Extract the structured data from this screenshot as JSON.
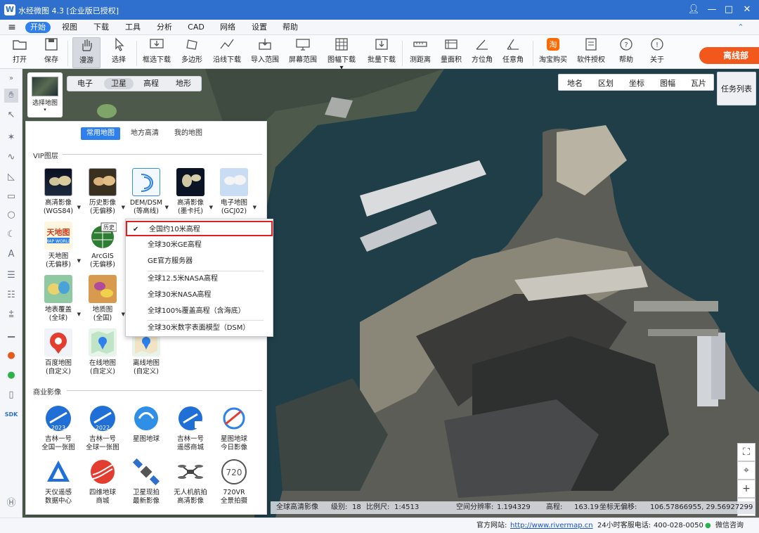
{
  "window": {
    "title": "水经微图 4.3 [企业版已授权]",
    "logo": "W"
  },
  "menu": {
    "items": [
      "开始",
      "视图",
      "下载",
      "工具",
      "分析",
      "CAD",
      "网络",
      "设置",
      "帮助"
    ]
  },
  "ribbon": {
    "open": "打开",
    "save": "保存",
    "roam": "漫游",
    "select": "选择",
    "frame_dl": "框选下载",
    "polygon": "多边形",
    "line_dl": "沿线下载",
    "import_range": "导入范围",
    "screen_range": "屏幕范围",
    "sheet_dl": "图幅下载",
    "batch_dl": "批量下载",
    "measure_dist": "测距离",
    "measure_area": "量面积",
    "azimuth": "方位角",
    "any_angle": "任意角",
    "taobao": "淘宝购买",
    "license": "软件授权",
    "help": "帮助",
    "about": "关于",
    "offline": "离线部"
  },
  "map": {
    "layer_types": [
      "电子",
      "卫星",
      "高程",
      "地形"
    ],
    "active_layer_type": "卫星",
    "thumb_label": "选择地图",
    "top_tabs": [
      "地名",
      "区划",
      "坐标",
      "图幅",
      "瓦片"
    ],
    "tasks": "任务列表",
    "zoom": {
      "in": "+",
      "out": "−"
    }
  },
  "status": {
    "layer": "全球高清影像",
    "level_label": "级别:",
    "level": "18",
    "scale_label": "比例尺:",
    "scale": "1:4513",
    "res_label": "空间分辨率:",
    "res": "1.194329",
    "elev_label": "高程:",
    "elev": "163.19",
    "coord_label": "坐标无偏移:",
    "coord": "106.57866955, 29.56927299"
  },
  "panel": {
    "tabs": [
      "常用地图",
      "地方高清",
      "我的地图"
    ],
    "active_tab": "常用地图",
    "vip_title": "VIP图层",
    "vip_items": [
      {
        "l1": "高清影像",
        "l2": "(WGS84)"
      },
      {
        "l1": "历史影像",
        "l2": "(无偏移)"
      },
      {
        "l1": "DEM/DSM",
        "l2": "(等高线)"
      },
      {
        "l1": "高清影像",
        "l2": "(墨卡托)"
      },
      {
        "l1": "电子地图",
        "l2": "(GCJ02)"
      },
      {
        "l1": "天地图",
        "l2": "(无偏移)"
      },
      {
        "l1": "ArcGIS",
        "l2": "(无偏移)"
      },
      {
        "l1": "地表覆盖",
        "l2": "(全球)"
      },
      {
        "l1": "地质图",
        "l2": "(全国)"
      },
      {
        "l1": "百度地图",
        "l2": "(自定义)"
      },
      {
        "l1": "在线地图",
        "l2": "(自定义)"
      },
      {
        "l1": "离线地图",
        "l2": "(自定义)"
      }
    ],
    "tdt_badge": "天地图",
    "tdt_sub": "MAP WORLD",
    "arcgis_badge": "历史",
    "commercial_title": "商业影像",
    "commercial_items": [
      {
        "l1": "吉林一号",
        "l2": "全国一张图",
        "badge": "2023"
      },
      {
        "l1": "吉林一号",
        "l2": "全球一张图",
        "badge": "2022"
      },
      {
        "l1": "星图地球",
        "l2": ""
      },
      {
        "l1": "吉林一号",
        "l2": "遥感商城"
      },
      {
        "l1": "星图地球",
        "l2": "今日影像"
      },
      {
        "l1": "天仪遥感",
        "l2": "数据中心"
      },
      {
        "l1": "四维地球",
        "l2": "商城"
      },
      {
        "l1": "卫星现拍",
        "l2": "最新影像"
      },
      {
        "l1": "无人机航拍",
        "l2": "高清影像"
      },
      {
        "l1": "720VR",
        "l2": "全景拍摄",
        "badge": "720"
      }
    ]
  },
  "dropdown": {
    "items": [
      "全国约10米高程",
      "全球30米GE高程",
      "GE官方服务器",
      "全球12.5米NASA高程",
      "全球30米NASA高程",
      "全球100%覆盖高程（含海底）",
      "全球30米数字表面模型（DSM）"
    ],
    "checked": "全国约10米高程",
    "check_mark": "✔"
  },
  "bottom": {
    "site_label": "官方网站:",
    "site": "http://www.rivermap.cn",
    "hotline_label": "24小时客服电话:",
    "hotline": "400-028-0050",
    "wechat": "微信咨询"
  },
  "left_tools": {
    "sdk": "SDK"
  },
  "colors": {
    "titlebar": "#2f6fcd",
    "accent": "#2f80ed",
    "offline": "#f2571c",
    "highlight_border": "#e02020"
  }
}
